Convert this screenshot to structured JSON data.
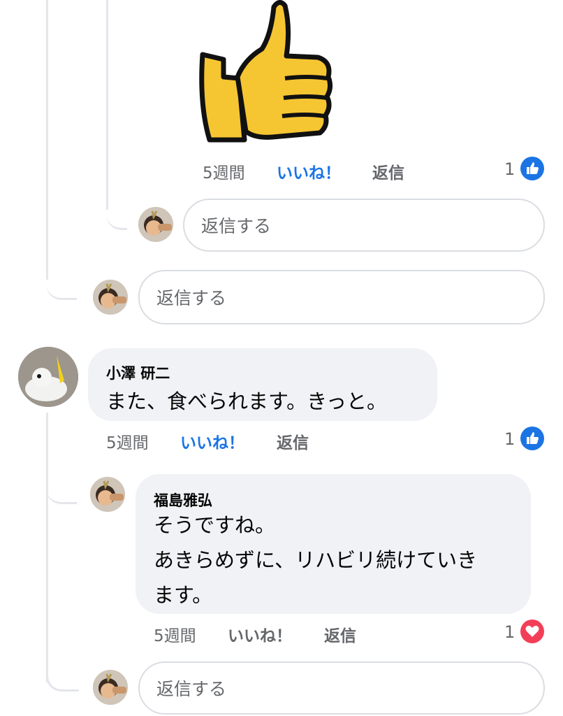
{
  "colors": {
    "like_blue": "#1b74e4",
    "love_red": "#f33e58",
    "meta_gray": "#65676b",
    "bubble_bg": "#f0f2f5",
    "thread_line": "#e4e6eb"
  },
  "comments": {
    "sticker_reply": {
      "sticker_icon": "thumbs-up-sticker",
      "time": "5週間",
      "like_label": "いいね！",
      "reply_label": "返信",
      "reaction_count": "1",
      "reaction_icon": "like-icon"
    },
    "reply_box_nested": {
      "placeholder": "返信する"
    },
    "reply_box_thread1": {
      "placeholder": "返信する"
    },
    "comment_ozawa": {
      "author": "小澤 研二",
      "text": "また、食べられます。きっと。",
      "time": "5週間",
      "like_label": "いいね！",
      "reply_label": "返信",
      "reaction_count": "1",
      "reaction_icon": "like-icon"
    },
    "reply_fukushima": {
      "author": "福島雅弘",
      "lines": [
        "そうですね。",
        "あきらめずに、リハビリ続けていき",
        "ます。"
      ],
      "time": "5週間",
      "like_label": "いいね！",
      "reply_label": "返信",
      "reaction_count": "1",
      "reaction_icon": "love-icon"
    },
    "reply_box_thread2": {
      "placeholder": "返信する"
    }
  }
}
